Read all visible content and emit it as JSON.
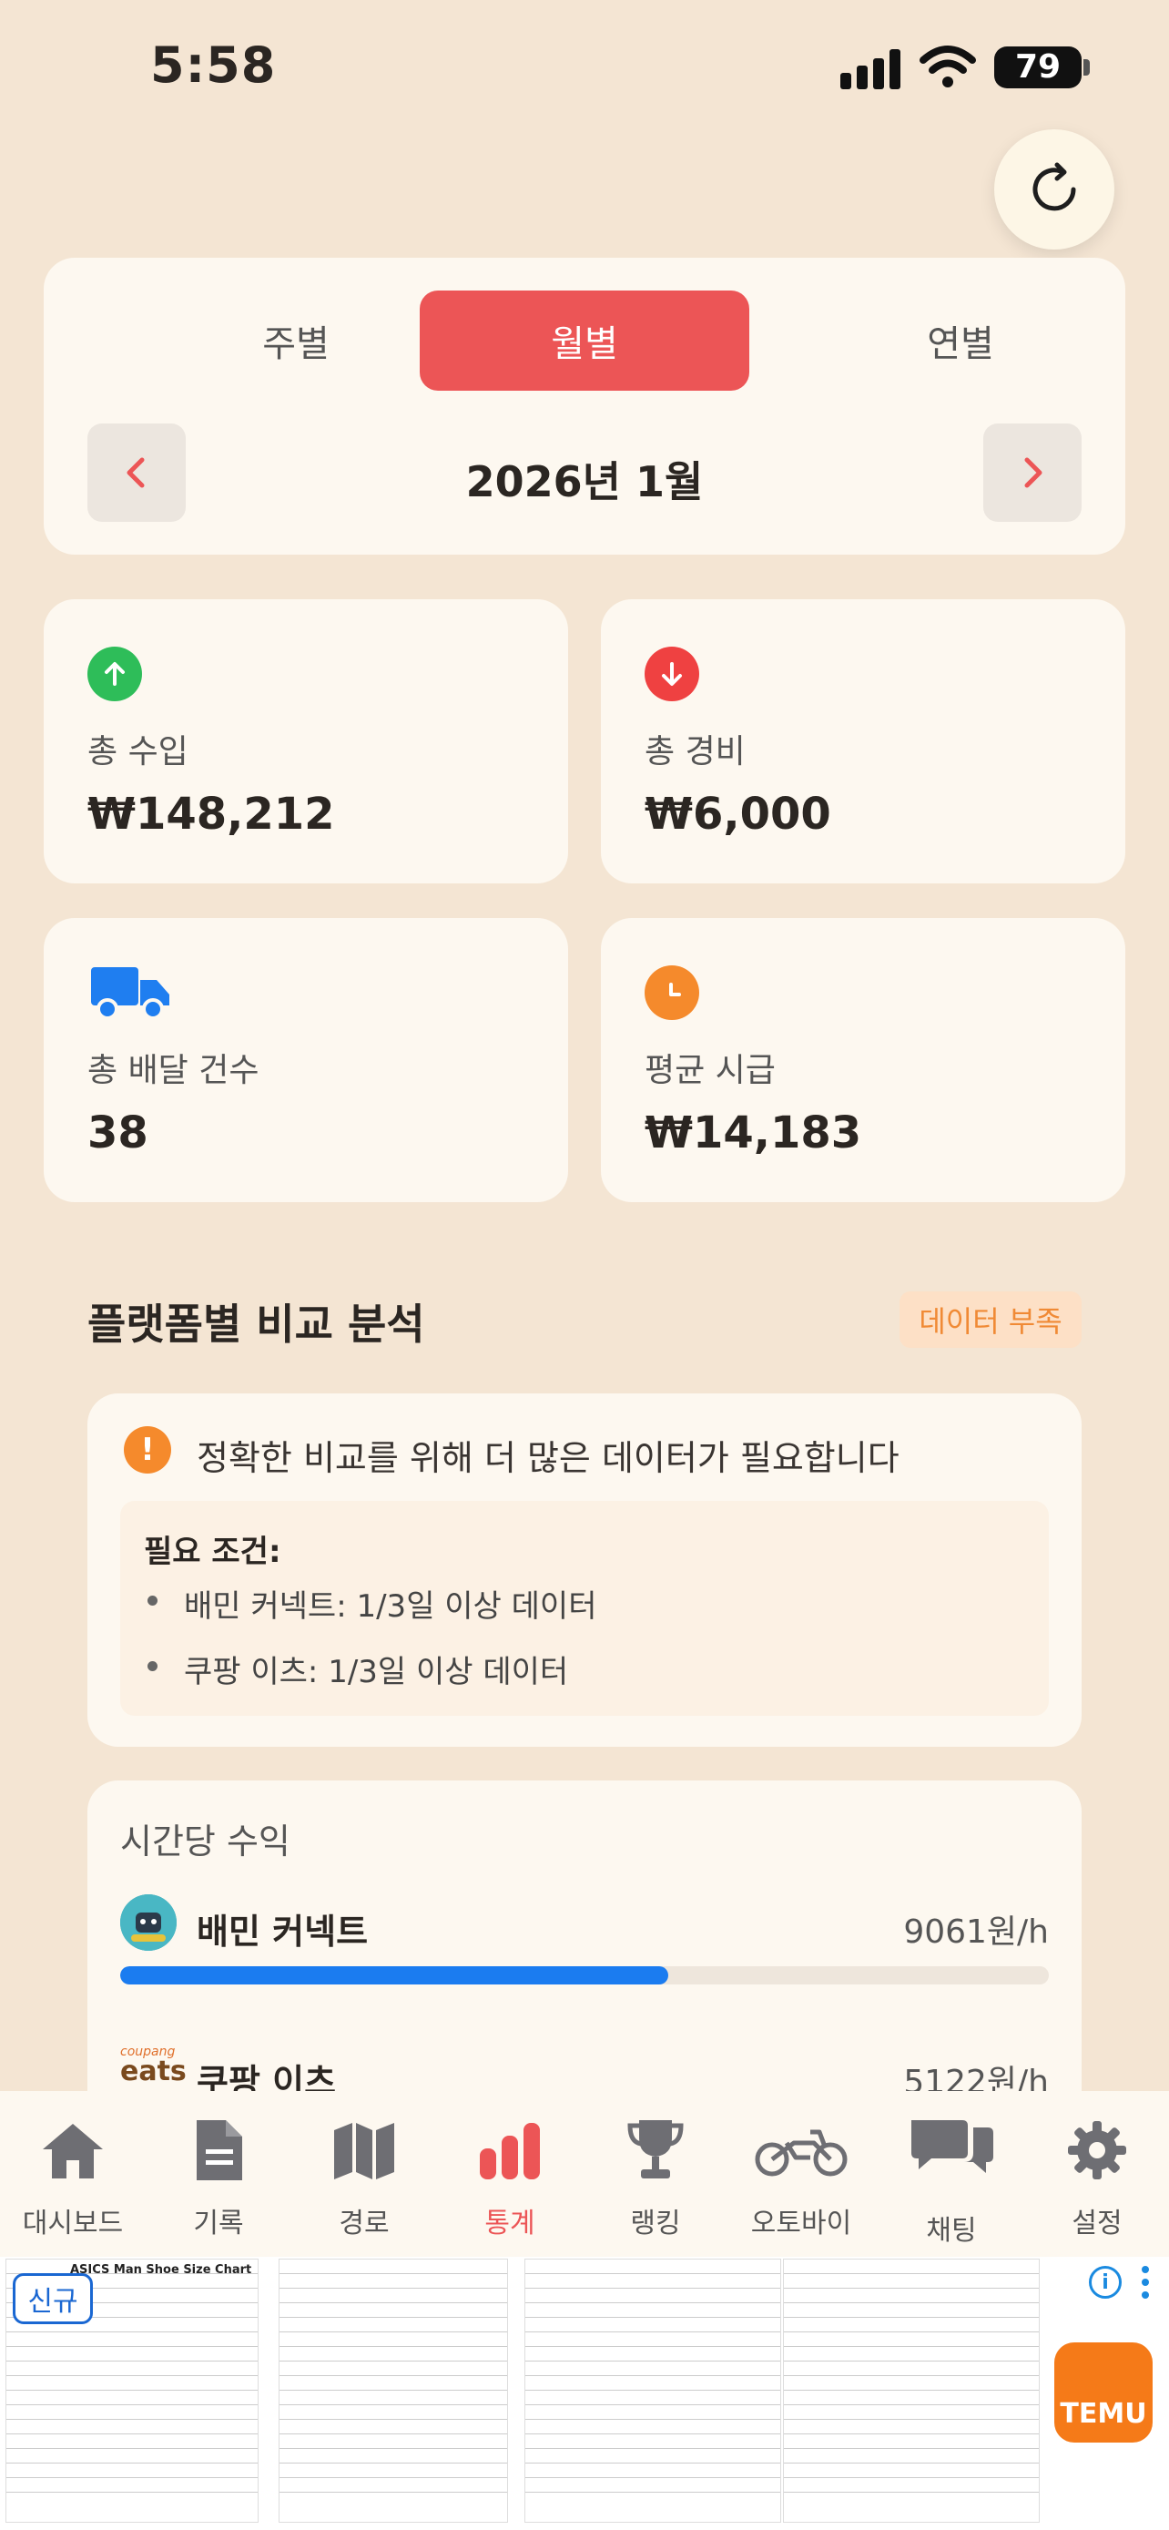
{
  "status_bar": {
    "time": "5:58",
    "battery": "79"
  },
  "period": {
    "tabs": [
      "주별",
      "월별",
      "연별"
    ],
    "selected": "월별",
    "current": "2026년 1월"
  },
  "stats": {
    "income": {
      "label": "총 수입",
      "value": "₩148,212",
      "color": "#2ebd59"
    },
    "expense": {
      "label": "총 경비",
      "value": "₩6,000",
      "color": "#ef4141"
    },
    "deliveries": {
      "label": "총 배달 건수",
      "value": "38",
      "color": "#1f7ef0"
    },
    "hourly_avg": {
      "label": "평균 시급",
      "value": "₩14,183",
      "color": "#f58a2c"
    }
  },
  "comparison": {
    "title": "플랫폼별 비교 분석",
    "badge": "데이터 부족",
    "warning": "정확한 비교를 위해 더 많은 데이터가 필요합니다",
    "requirements_title": "필요 조건:",
    "requirements": [
      "배민 커넥트: 1/3일 이상 데이터",
      "쿠팡 이츠: 1/3일 이상 데이터"
    ]
  },
  "hourly": {
    "title": "시간당 수익",
    "platforms": [
      {
        "name": "배민 커넥트",
        "value": "9061원/h",
        "fraction": 0.59
      },
      {
        "name": "쿠팡 이츠",
        "value": "5122원/h",
        "logo_text_top": "coupang",
        "logo_text_bottom": "eats"
      }
    ]
  },
  "tabbar": {
    "items": [
      {
        "label": "대시보드",
        "icon": "home-icon"
      },
      {
        "label": "기록",
        "icon": "document-icon"
      },
      {
        "label": "경로",
        "icon": "map-icon"
      },
      {
        "label": "통계",
        "icon": "bar-chart-icon"
      },
      {
        "label": "랭킹",
        "icon": "trophy-icon"
      },
      {
        "label": "오토바이",
        "icon": "motorcycle-icon"
      },
      {
        "label": "채팅",
        "icon": "chat-icon"
      },
      {
        "label": "설정",
        "icon": "gear-icon"
      }
    ],
    "active": "통계",
    "active_color": "#ec5556"
  },
  "ad": {
    "new_label": "신규",
    "chart_title": "ASICS Man Shoe Size Chart",
    "brand": "TEMU",
    "info": "i"
  }
}
